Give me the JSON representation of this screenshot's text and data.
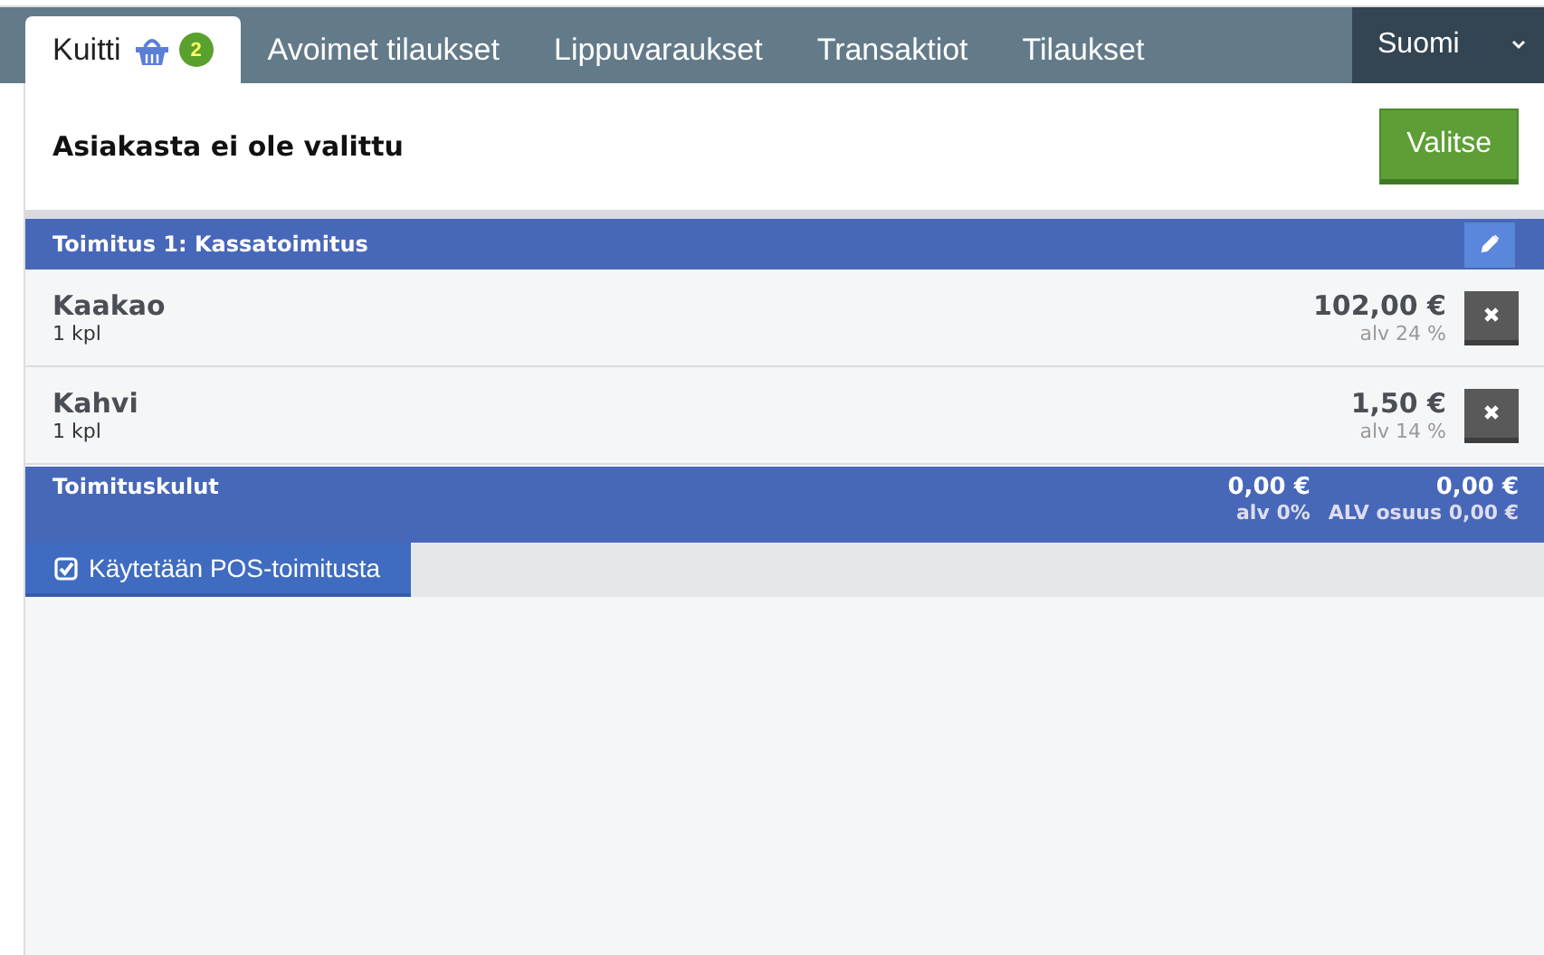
{
  "tabs": [
    {
      "label": "Kuitti",
      "selected": true,
      "badge": "2"
    },
    {
      "label": "Avoimet tilaukset",
      "selected": false
    },
    {
      "label": "Lippuvaraukset",
      "selected": false
    },
    {
      "label": "Transaktiot",
      "selected": false
    },
    {
      "label": "Tilaukset",
      "selected": false
    }
  ],
  "language": {
    "value": "Suomi"
  },
  "customer": {
    "text": "Asiakasta ei ole valittu",
    "button": "Valitse"
  },
  "delivery": {
    "title": "Toimitus 1: Kassatoimitus",
    "items": [
      {
        "name": "Kaakao",
        "quantity": "1 kpl",
        "price": "102,00 €",
        "vat": "alv 24 %"
      },
      {
        "name": "Kahvi",
        "quantity": "1 kpl",
        "price": "1,50 €",
        "vat": "alv 14 %"
      }
    ],
    "shipping": {
      "label": "Toimituskulut",
      "price": "0,00 €",
      "vat": "alv 0%",
      "total": "0,00 €",
      "vat_share": "ALV osuus 0,00 €"
    },
    "pos_option": {
      "label": "Käytetään POS-toimitusta",
      "checked": true
    }
  }
}
